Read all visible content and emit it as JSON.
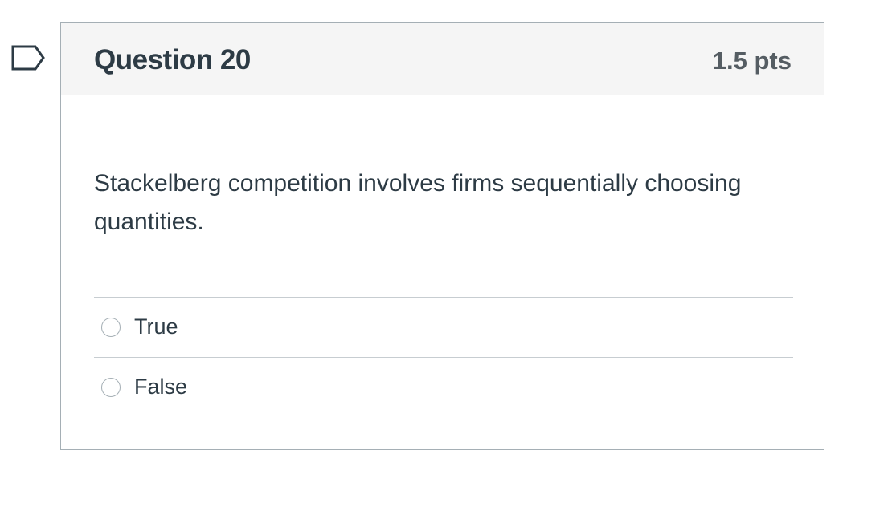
{
  "question": {
    "title": "Question 20",
    "points": "1.5 pts",
    "text": "Stackelberg competition involves firms sequentially choosing quantities.",
    "flag_icon": "flag-icon",
    "answers": [
      {
        "label": "True",
        "selected": false
      },
      {
        "label": "False",
        "selected": false
      }
    ]
  },
  "colors": {
    "text": "#2d3b45",
    "header_bg": "#f5f5f5",
    "border": "#a5afb5",
    "points_text": "#555d63"
  }
}
